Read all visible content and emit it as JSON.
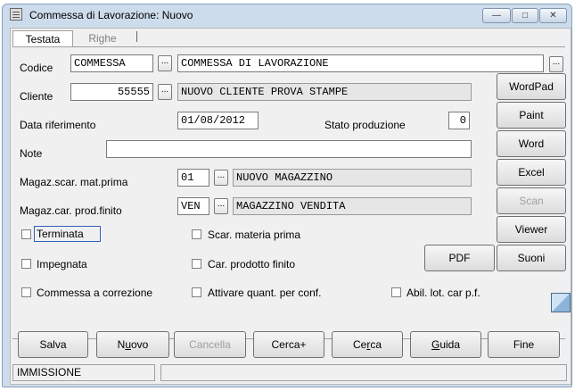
{
  "window": {
    "title": "Commessa di Lavorazione: Nuovo",
    "min_glyph": "—",
    "max_glyph": "□",
    "close_glyph": "✕"
  },
  "tabs": [
    "Testata",
    "Righe"
  ],
  "form": {
    "codice": {
      "label": "Codice",
      "value": "COMMESSA",
      "desc": "COMMESSA DI LAVORAZIONE"
    },
    "cliente": {
      "label": "Cliente",
      "value": "55555",
      "desc": "NUOVO CLIENTE PROVA STAMPE"
    },
    "data_riferimento": {
      "label": "Data riferimento",
      "value": "01/08/2012"
    },
    "stato_produzione": {
      "label": "Stato produzione",
      "value": "0"
    },
    "note": {
      "label": "Note",
      "value": ""
    },
    "magaz_scar": {
      "label": "Magaz.scar. mat.prima",
      "value": "01",
      "desc": "NUOVO MAGAZZINO"
    },
    "magaz_car": {
      "label": "Magaz.car. prod.finito",
      "value": "VEN",
      "desc": "MAGAZZINO VENDITA"
    },
    "lookup_glyph": "..."
  },
  "checkboxes": {
    "terminata": "Terminata",
    "impegnata": "Impegnata",
    "commessa_correzione": "Commessa a correzione",
    "scar_materia_prima": "Scar. materia prima",
    "car_prodotto_finito": "Car. prodotto finito",
    "attivare_quant": "Attivare quant. per conf.",
    "abil_lot": "Abil. lot. car p.f."
  },
  "side_buttons": {
    "wordpad": "WordPad",
    "paint": "Paint",
    "word": "Word",
    "excel": "Excel",
    "scan": "Scan",
    "viewer": "Viewer",
    "pdf": "PDF",
    "suoni": "Suoni"
  },
  "bottom_buttons": {
    "salva": "Salva",
    "nuovo": {
      "pre": "N",
      "ul": "u",
      "post": "ovo"
    },
    "cancella": "Cancella",
    "cerca_plus": "Cerca+",
    "cerca": {
      "pre": "Ce",
      "ul": "r",
      "post": "ca"
    },
    "guida": {
      "pre": "",
      "ul": "G",
      "post": "uida"
    },
    "fine": "Fine"
  },
  "status": {
    "mode": "IMMISSIONE",
    "message": ""
  }
}
